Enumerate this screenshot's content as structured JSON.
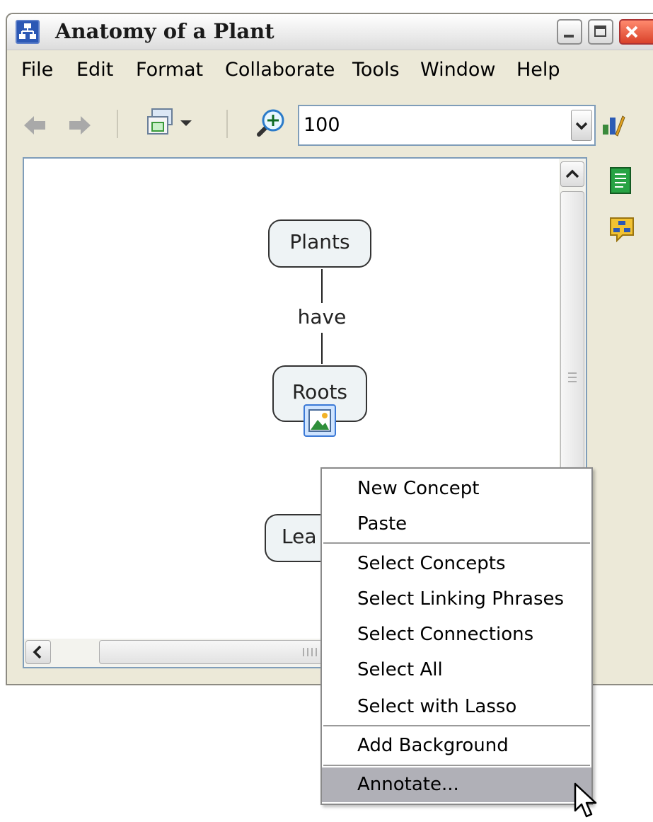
{
  "window": {
    "title": "Anatomy of a Plant"
  },
  "menubar": {
    "items": [
      "File",
      "Edit",
      "Format",
      "Collaborate",
      "Tools",
      "Window",
      "Help"
    ]
  },
  "toolbar": {
    "zoom_value": "100",
    "icons": [
      "back-arrow-icon",
      "forward-arrow-icon",
      "map-view-icon",
      "zoom-icon",
      "edit-style-icon"
    ]
  },
  "map": {
    "concepts": {
      "plants": "Plants",
      "roots": "Roots",
      "leaves_partial": "Lea"
    },
    "linking_phrase": "have"
  },
  "context_menu": {
    "items": [
      "New Concept",
      "Paste",
      "Select Concepts",
      "Select Linking Phrases",
      "Select Connections",
      "Select All",
      "Select with Lasso",
      "Add Background",
      "Annotate..."
    ],
    "highlighted": "Annotate..."
  },
  "colors": {
    "window_bg": "#ece9d8",
    "concept_fill": "#eef3f5",
    "menu_highlight": "#b0b0b7",
    "field_border": "#7f9db9"
  }
}
